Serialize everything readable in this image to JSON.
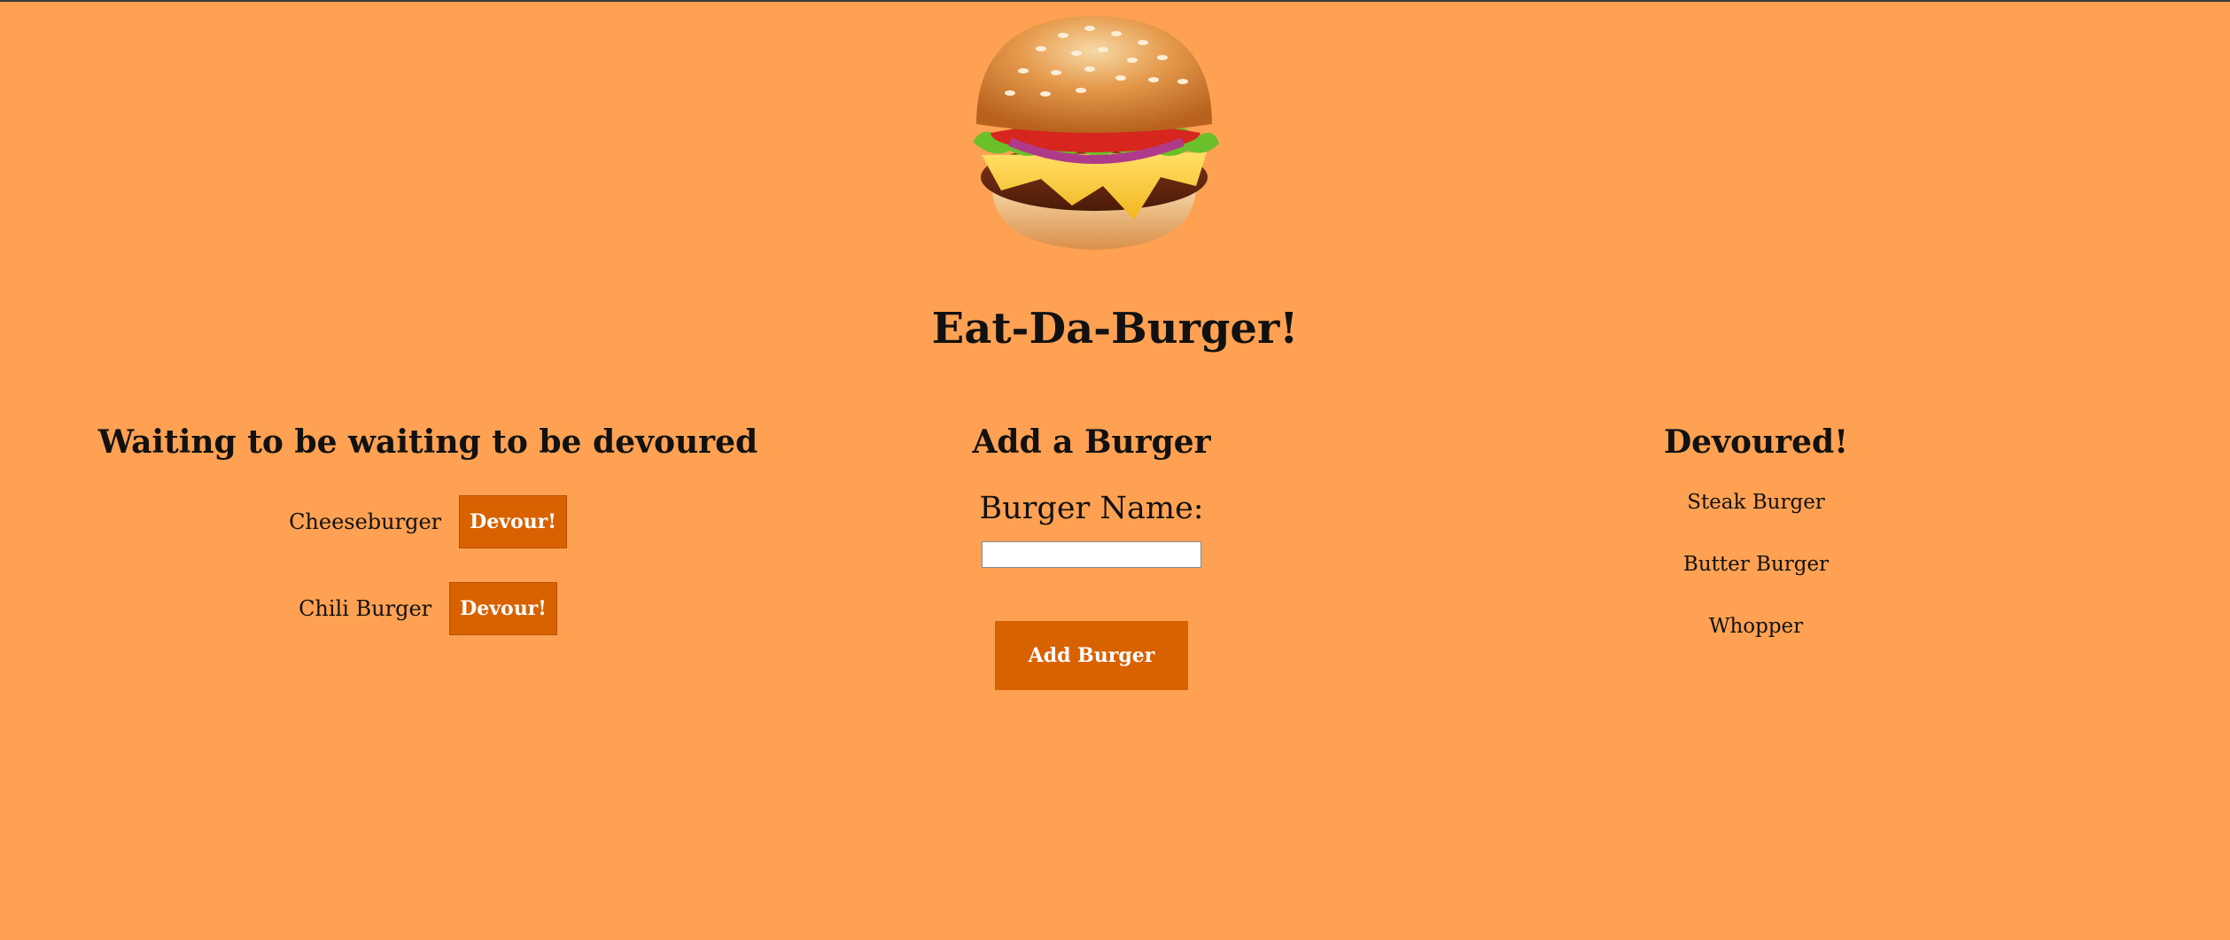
{
  "page": {
    "title": "Eat-Da-Burger!"
  },
  "colors": {
    "background": "#ffa152",
    "button": "#d96200",
    "button_text": "#ffffff"
  },
  "hero": {
    "icon": "burger-image"
  },
  "waiting": {
    "heading": "Waiting to be waiting to be devoured",
    "items": [
      {
        "name": "Cheeseburger",
        "button_label": "Devour!"
      },
      {
        "name": "Chili Burger",
        "button_label": "Devour!"
      }
    ]
  },
  "add": {
    "heading": "Add a Burger",
    "label": "Burger Name:",
    "input_value": "",
    "button_label": "Add Burger"
  },
  "devoured": {
    "heading": "Devoured!",
    "items": [
      "Steak Burger",
      "Butter Burger",
      "Whopper"
    ]
  }
}
